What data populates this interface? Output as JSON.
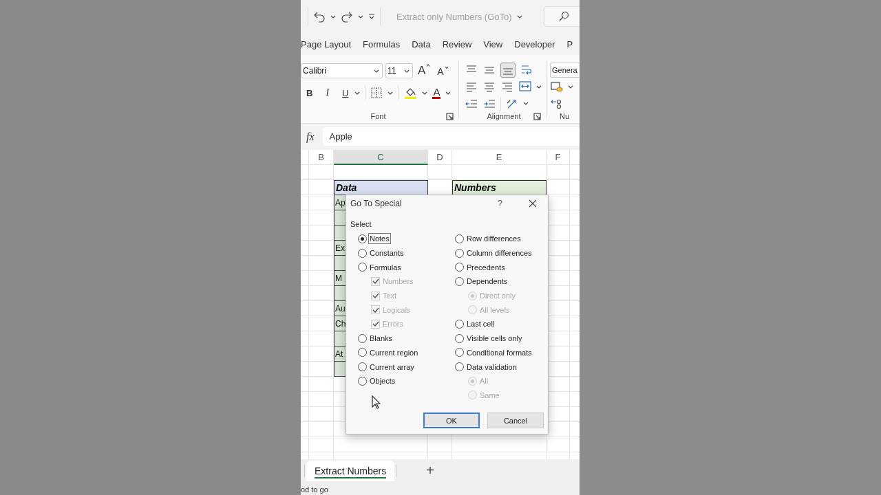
{
  "title_bar": {
    "title": "Extract only Numbers (GoTo)"
  },
  "ribbon_tabs": [
    "Page Layout",
    "Formulas",
    "Data",
    "Review",
    "View",
    "Developer",
    "P"
  ],
  "ribbon": {
    "font": {
      "name": "Calibri",
      "size": "11",
      "grow": "A",
      "shrink": "A",
      "bold": "B",
      "italic": "I",
      "underline": "U",
      "color_letter": "A",
      "label": "Font"
    },
    "alignment": {
      "label": "Alignment"
    },
    "number": {
      "format": "Genera",
      "label": "Nu"
    }
  },
  "formula_bar": {
    "fx": "fx",
    "value": "Apple"
  },
  "columns": [
    {
      "label": "B",
      "selected": false
    },
    {
      "label": "C",
      "selected": true
    },
    {
      "label": "D",
      "selected": false
    },
    {
      "label": "E",
      "selected": false
    },
    {
      "label": "F",
      "selected": false
    }
  ],
  "headers": [
    "Data",
    "Numbers"
  ],
  "column_c": [
    {
      "kind": "text",
      "text": "Ap"
    },
    {
      "kind": "blank"
    },
    {
      "kind": "blank"
    },
    {
      "kind": "text",
      "text": "Ex"
    },
    {
      "kind": "blank"
    },
    {
      "kind": "text",
      "text": "M"
    },
    {
      "kind": "blank"
    },
    {
      "kind": "text",
      "text": "Au"
    },
    {
      "kind": "text",
      "text": "Ch"
    },
    {
      "kind": "blank"
    },
    {
      "kind": "text",
      "text": "At"
    },
    {
      "kind": "blank"
    }
  ],
  "dialog": {
    "title": "Go To Special",
    "help": "?",
    "group_label": "Select",
    "left": [
      {
        "kind": "radio",
        "label": "Notes",
        "selected": true,
        "disabled": false
      },
      {
        "kind": "radio",
        "label": "Constants",
        "selected": false,
        "disabled": false
      },
      {
        "kind": "radio",
        "label": "Formulas",
        "selected": false,
        "disabled": false,
        "children": [
          {
            "kind": "checkbox",
            "label": "Numbers",
            "checked": true,
            "disabled": true
          },
          {
            "kind": "checkbox",
            "label": "Text",
            "checked": true,
            "disabled": true
          },
          {
            "kind": "checkbox",
            "label": "Logicals",
            "checked": true,
            "disabled": true
          },
          {
            "kind": "checkbox",
            "label": "Errors",
            "checked": true,
            "disabled": true
          }
        ]
      },
      {
        "kind": "radio",
        "label": "Blanks",
        "selected": false,
        "disabled": false
      },
      {
        "kind": "radio",
        "label": "Current region",
        "selected": false,
        "disabled": false
      },
      {
        "kind": "radio",
        "label": "Current array",
        "selected": false,
        "disabled": false
      },
      {
        "kind": "radio",
        "label": "Objects",
        "selected": false,
        "disabled": false
      }
    ],
    "right": [
      {
        "kind": "radio",
        "label": "Row differences",
        "selected": false,
        "disabled": false
      },
      {
        "kind": "radio",
        "label": "Column differences",
        "selected": false,
        "disabled": false
      },
      {
        "kind": "radio",
        "label": "Precedents",
        "selected": false,
        "disabled": false
      },
      {
        "kind": "radio",
        "label": "Dependents",
        "selected": false,
        "disabled": false,
        "children": [
          {
            "kind": "radio",
            "label": "Direct only",
            "selected": true,
            "disabled": true
          },
          {
            "kind": "radio",
            "label": "All levels",
            "selected": false,
            "disabled": true
          }
        ]
      },
      {
        "kind": "radio",
        "label": "Last cell",
        "selected": false,
        "disabled": false
      },
      {
        "kind": "radio",
        "label": "Visible cells only",
        "selected": false,
        "disabled": false
      },
      {
        "kind": "radio",
        "label": "Conditional formats",
        "selected": false,
        "disabled": false
      },
      {
        "kind": "radio",
        "label": "Data validation",
        "selected": false,
        "disabled": false,
        "children": [
          {
            "kind": "radio",
            "label": "All",
            "selected": true,
            "disabled": true
          },
          {
            "kind": "radio",
            "label": "Same",
            "selected": false,
            "disabled": true
          }
        ]
      }
    ],
    "buttons": [
      {
        "label": "OK",
        "default": true
      },
      {
        "label": "Cancel",
        "default": false
      }
    ]
  },
  "sheet_tabs": [
    {
      "label": "Extract Numbers",
      "selected": true
    }
  ],
  "add_sheet": "+",
  "status_bar": {
    "text": "od to go"
  }
}
